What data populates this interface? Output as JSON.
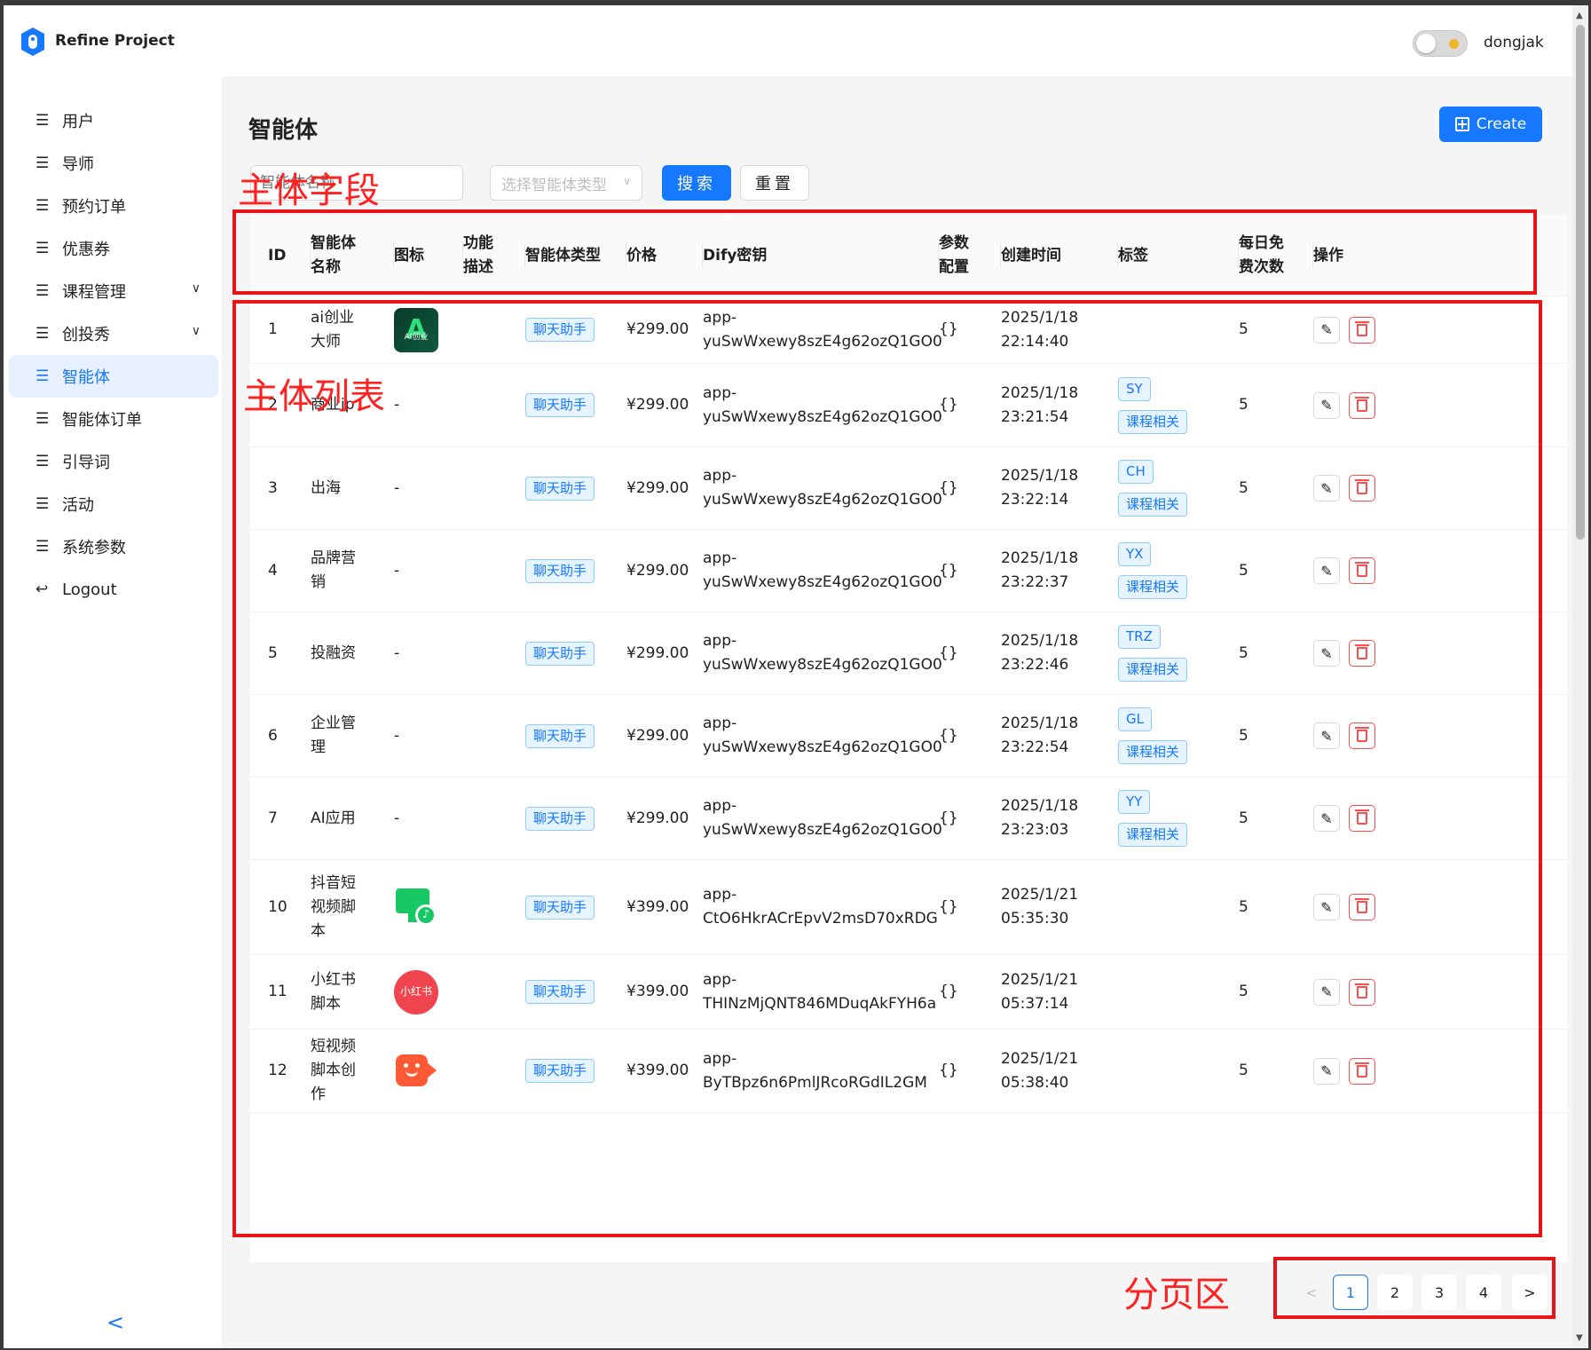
{
  "app": {
    "title": "Refine Project",
    "username": "dongjak"
  },
  "sidebar": {
    "items": [
      {
        "label": "用户"
      },
      {
        "label": "导师"
      },
      {
        "label": "预约订单"
      },
      {
        "label": "优惠券"
      },
      {
        "label": "课程管理",
        "expandable": true
      },
      {
        "label": "创投秀",
        "expandable": true
      },
      {
        "label": "智能体",
        "active": true
      },
      {
        "label": "智能体订单"
      },
      {
        "label": "引导词"
      },
      {
        "label": "活动"
      },
      {
        "label": "系统参数"
      },
      {
        "label": "Logout"
      }
    ],
    "collapse_glyph": "<"
  },
  "page": {
    "title": "智能体",
    "create_label": "Create",
    "search_placeholder": "智能体名称",
    "type_select_placeholder": "选择智能体类型",
    "search_label": "搜索",
    "reset_label": "重置"
  },
  "annotations": {
    "fields": "主体字段",
    "list": "主体列表",
    "pagination": "分页区"
  },
  "table": {
    "columns": [
      "ID",
      "智能体名称",
      "图标",
      "功能描述",
      "智能体类型",
      "价格",
      "Dify密钥",
      "参数配置",
      "创建时间",
      "标签",
      "每日免费次数",
      "操作"
    ],
    "column_lines": {
      "name": [
        "智能体",
        "名称"
      ],
      "desc": [
        "功能",
        "描述"
      ],
      "params": [
        "参数",
        "配置"
      ],
      "free": [
        "每日免",
        "费次数"
      ]
    },
    "rows": [
      {
        "id": "1",
        "name_lines": [
          "ai创业",
          "大师"
        ],
        "icon": "ai-icon",
        "type": "聊天助手",
        "price": "¥299.00",
        "key_lines": [
          "app-",
          "yuSwWxewy8szE4g62ozQ1GO0"
        ],
        "params": "{}",
        "date_lines": [
          "2025/1/18",
          "22:14:40"
        ],
        "tags": [],
        "free": "5"
      },
      {
        "id": "2",
        "name_lines": [
          "商业ip"
        ],
        "icon_text": "-",
        "type": "聊天助手",
        "price": "¥299.00",
        "key_lines": [
          "app-",
          "yuSwWxewy8szE4g62ozQ1GO0"
        ],
        "params": "{}",
        "date_lines": [
          "2025/1/18",
          "23:21:54"
        ],
        "tags": [
          "SY",
          "课程相关"
        ],
        "free": "5"
      },
      {
        "id": "3",
        "name_lines": [
          "出海"
        ],
        "icon_text": "-",
        "type": "聊天助手",
        "price": "¥299.00",
        "key_lines": [
          "app-",
          "yuSwWxewy8szE4g62ozQ1GO0"
        ],
        "params": "{}",
        "date_lines": [
          "2025/1/18",
          "23:22:14"
        ],
        "tags": [
          "CH",
          "课程相关"
        ],
        "free": "5"
      },
      {
        "id": "4",
        "name_lines": [
          "品牌营",
          "销"
        ],
        "icon_text": "-",
        "type": "聊天助手",
        "price": "¥299.00",
        "key_lines": [
          "app-",
          "yuSwWxewy8szE4g62ozQ1GO0"
        ],
        "params": "{}",
        "date_lines": [
          "2025/1/18",
          "23:22:37"
        ],
        "tags": [
          "YX",
          "课程相关"
        ],
        "free": "5"
      },
      {
        "id": "5",
        "name_lines": [
          "投融资"
        ],
        "icon_text": "-",
        "type": "聊天助手",
        "price": "¥299.00",
        "key_lines": [
          "app-",
          "yuSwWxewy8szE4g62ozQ1GO0"
        ],
        "params": "{}",
        "date_lines": [
          "2025/1/18",
          "23:22:46"
        ],
        "tags": [
          "TRZ",
          "课程相关"
        ],
        "free": "5"
      },
      {
        "id": "6",
        "name_lines": [
          "企业管",
          "理"
        ],
        "icon_text": "-",
        "type": "聊天助手",
        "price": "¥299.00",
        "key_lines": [
          "app-",
          "yuSwWxewy8szE4g62ozQ1GO0"
        ],
        "params": "{}",
        "date_lines": [
          "2025/1/18",
          "23:22:54"
        ],
        "tags": [
          "GL",
          "课程相关"
        ],
        "free": "5"
      },
      {
        "id": "7",
        "name_lines": [
          "AI应用"
        ],
        "icon_text": "-",
        "type": "聊天助手",
        "price": "¥299.00",
        "key_lines": [
          "app-",
          "yuSwWxewy8szE4g62ozQ1GO0"
        ],
        "params": "{}",
        "date_lines": [
          "2025/1/18",
          "23:23:03"
        ],
        "tags": [
          "YY",
          "课程相关"
        ],
        "free": "5"
      },
      {
        "id": "10",
        "name_lines": [
          "抖音短",
          "视频脚",
          "本"
        ],
        "icon": "douyin-icon",
        "type": "聊天助手",
        "price": "¥399.00",
        "key_lines": [
          "app-",
          "CtO6HkrACrEpvV2msD70xRDG"
        ],
        "params": "{}",
        "date_lines": [
          "2025/1/21",
          "05:35:30"
        ],
        "tags": [],
        "free": "5"
      },
      {
        "id": "11",
        "name_lines": [
          "小红书",
          "脚本"
        ],
        "icon": "xiaohongshu-icon",
        "icon_text": "小红书",
        "type": "聊天助手",
        "price": "¥399.00",
        "key_lines": [
          "app-",
          "THINzMjQNT846MDuqAkFYH6a"
        ],
        "params": "{}",
        "date_lines": [
          "2025/1/21",
          "05:37:14"
        ],
        "tags": [],
        "free": "5"
      },
      {
        "id": "12",
        "name_lines": [
          "短视频",
          "脚本创",
          "作"
        ],
        "icon": "video-camera-icon",
        "type": "聊天助手",
        "price": "¥399.00",
        "key_lines": [
          "app-",
          "ByTBpz6n6PmlJRcoRGdIL2GM"
        ],
        "params": "{}",
        "date_lines": [
          "2025/1/21",
          "05:38:40"
        ],
        "tags": [],
        "free": "5"
      }
    ]
  },
  "ai_icon_text": "AI创业",
  "pagination": {
    "prev": "<",
    "next": ">",
    "pages": [
      "1",
      "2",
      "3",
      "4"
    ],
    "current": "1"
  },
  "colors": {
    "primary": "#1677ff",
    "danger": "#ff4d4f",
    "annotation": "#e8141a",
    "active_nav_bg": "#e6f0ff"
  }
}
